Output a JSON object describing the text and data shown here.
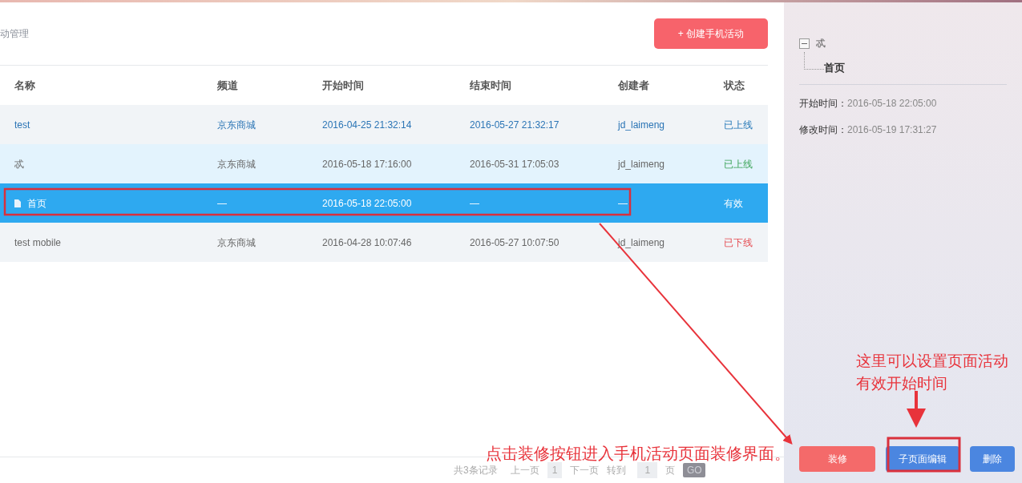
{
  "breadcrumb": "动管理",
  "create_button": "+ 创建手机活动",
  "table": {
    "columns": [
      "名称",
      "频道",
      "开始时间",
      "结束时间",
      "创建者",
      "状态"
    ],
    "rows": [
      {
        "kind": "activity",
        "hovered": true,
        "expanded": false,
        "selected": false,
        "cells": [
          "test",
          "京东商城",
          "2016-04-25 21:32:14",
          "2016-05-27 21:32:17",
          "jd_laimeng"
        ],
        "status": {
          "text": "已上线",
          "kind": "online"
        }
      },
      {
        "kind": "activity",
        "hovered": false,
        "expanded": true,
        "selected": false,
        "cells": [
          "忒",
          "京东商城",
          "2016-05-18 17:16:00",
          "2016-05-31 17:05:03",
          "jd_laimeng"
        ],
        "status": {
          "text": "已上线",
          "kind": "online"
        }
      },
      {
        "kind": "page",
        "hovered": false,
        "expanded": false,
        "selected": true,
        "cells": [
          "首页",
          "—",
          "2016-05-18 22:05:00",
          "—",
          "—"
        ],
        "status": {
          "text": "有效",
          "kind": "valid"
        }
      },
      {
        "kind": "activity",
        "hovered": false,
        "expanded": false,
        "selected": false,
        "cells": [
          "test mobile",
          "京东商城",
          "2016-04-28 10:07:46",
          "2016-05-27 10:07:50",
          "jd_laimeng"
        ],
        "status": {
          "text": "已下线",
          "kind": "offline"
        }
      }
    ]
  },
  "pagination": {
    "total": "共3条记录",
    "prev": "上一页",
    "page": "1",
    "next": "下一页",
    "goto": "转到",
    "page_input": "1",
    "page_unit": "页",
    "go": "GO"
  },
  "side_panel": {
    "tree": {
      "label": "忒",
      "expanded": true,
      "children": [
        {
          "label": "首页"
        }
      ]
    },
    "fields": [
      {
        "label": "开始时间：",
        "value": "2016-05-18 22:05:00"
      },
      {
        "label": "修改时间：",
        "value": "2016-05-19 17:31:27"
      }
    ],
    "buttons": [
      {
        "kind": "danger",
        "label": "装修"
      },
      {
        "kind": "primary",
        "label": "子页面编辑"
      },
      {
        "kind": "primary",
        "label": "删除"
      }
    ]
  },
  "annotations": [
    {
      "text": "点击装修按钮进入手机活动页面装修界面。"
    },
    {
      "text": "这里可以设置页面活动有效开始时间"
    }
  ]
}
